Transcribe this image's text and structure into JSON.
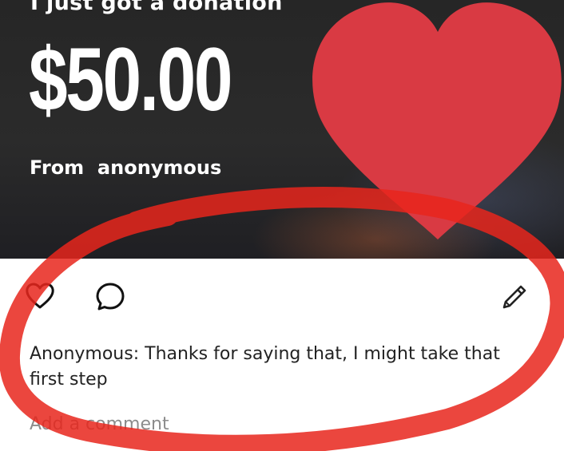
{
  "post": {
    "headline": "I just got a donation",
    "amount": "$50.00",
    "from_prefix": "From",
    "from_name": "anonymous"
  },
  "comments": [
    {
      "author": "Anonymous",
      "text": "Thanks for saying that, I might take that first step"
    }
  ],
  "add_comment": {
    "placeholder": "Add a comment"
  },
  "icons": {
    "like": "heart-outline-icon",
    "comment": "speech-bubble-icon",
    "edit": "pencil-icon",
    "decoration": "red-heart-icon"
  },
  "colors": {
    "heart": "#d93a43",
    "annotation": "#e8261c",
    "banner": "#262626"
  }
}
